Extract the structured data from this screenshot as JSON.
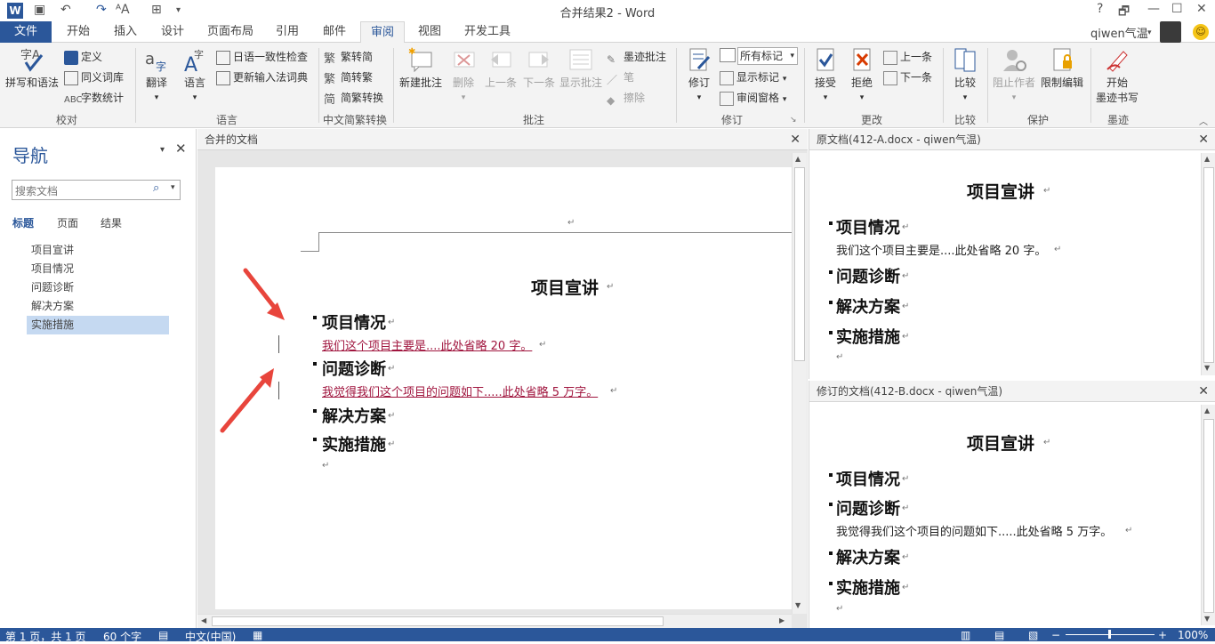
{
  "title": "合并结果2 - Word",
  "window_controls": {
    "help": "?",
    "restore": "🗗",
    "minimize": "—",
    "maximize": "☐",
    "close": "✕"
  },
  "tabs": [
    "文件",
    "开始",
    "插入",
    "设计",
    "页面布局",
    "引用",
    "邮件",
    "审阅",
    "视图",
    "开发工具"
  ],
  "user": "qiwen气温",
  "ribbon": {
    "groups": {
      "proofing": "校对",
      "language": "语言",
      "chinese": "中文简繁转换",
      "comments": "批注",
      "tracking": "修订",
      "changes": "更改",
      "compare": "比较",
      "protect": "保护",
      "ink": "墨迹"
    },
    "spelling": "拼写和语法",
    "define": "定义",
    "thesaurus": "同义词库",
    "wordcount": "字数统计",
    "translate": "翻译",
    "language": "语言",
    "jp_check": "日语一致性检查",
    "reconvert": "更新输入法词典",
    "to_simplified": "繁转简",
    "to_traditional": "简转繁",
    "convert": "简繁转换",
    "new_comment": "新建批注",
    "delete": "删除",
    "prev": "上一条",
    "next": "下一条",
    "show_comments": "显示批注",
    "ink_comment": "墨迹批注",
    "pen": "笔",
    "eraser": "擦除",
    "track": "修订",
    "all_markup": "所有标记",
    "show_markup": "显示标记",
    "review_pane": "审阅窗格",
    "accept": "接受",
    "reject": "拒绝",
    "prev_change": "上一条",
    "next_change": "下一条",
    "compare_btn": "比较",
    "block_authors": "阻止作者",
    "restrict": "限制编辑",
    "start_ink": "开始",
    "start_ink2": "墨迹书写"
  },
  "nav": {
    "title": "导航",
    "search_placeholder": "搜索文档",
    "tabs": [
      "标题",
      "页面",
      "结果"
    ],
    "items": [
      "项目宣讲",
      "项目情况",
      "问题诊断",
      "解决方案",
      "实施措施"
    ]
  },
  "merged": {
    "header": "合并的文档",
    "title": "项目宣讲",
    "h_situation": "项目情况",
    "p_situation": "我们这个项目主要是....此处省略 20 字。",
    "h_problem": "问题诊断",
    "p_problem": "我觉得我们这个项目的问题如下.....此处省略 5 万字。",
    "h_solution": "解决方案",
    "h_measures": "实施措施"
  },
  "original": {
    "header": "原文档(412-A.docx - qiwen气温)",
    "title": "项目宣讲",
    "h_situation": "项目情况",
    "p_situation": "我们这个项目主要是....此处省略 20 字。",
    "h_problem": "问题诊断",
    "h_solution": "解决方案",
    "h_measures": "实施措施"
  },
  "revised": {
    "header": "修订的文档(412-B.docx - qiwen气温)",
    "title": "项目宣讲",
    "h_situation": "项目情况",
    "h_problem": "问题诊断",
    "p_problem": "我觉得我们这个项目的问题如下.....此处省略 5 万字。",
    "h_solution": "解决方案",
    "h_measures": "实施措施"
  },
  "status": {
    "page": "第 1 页，共 1 页",
    "words": "60 个字",
    "lang": "中文(中国)",
    "zoom": "100%"
  },
  "colors": {
    "accent": "#2b579a",
    "revision": "#a0153e",
    "arrow": "#e8453c"
  }
}
